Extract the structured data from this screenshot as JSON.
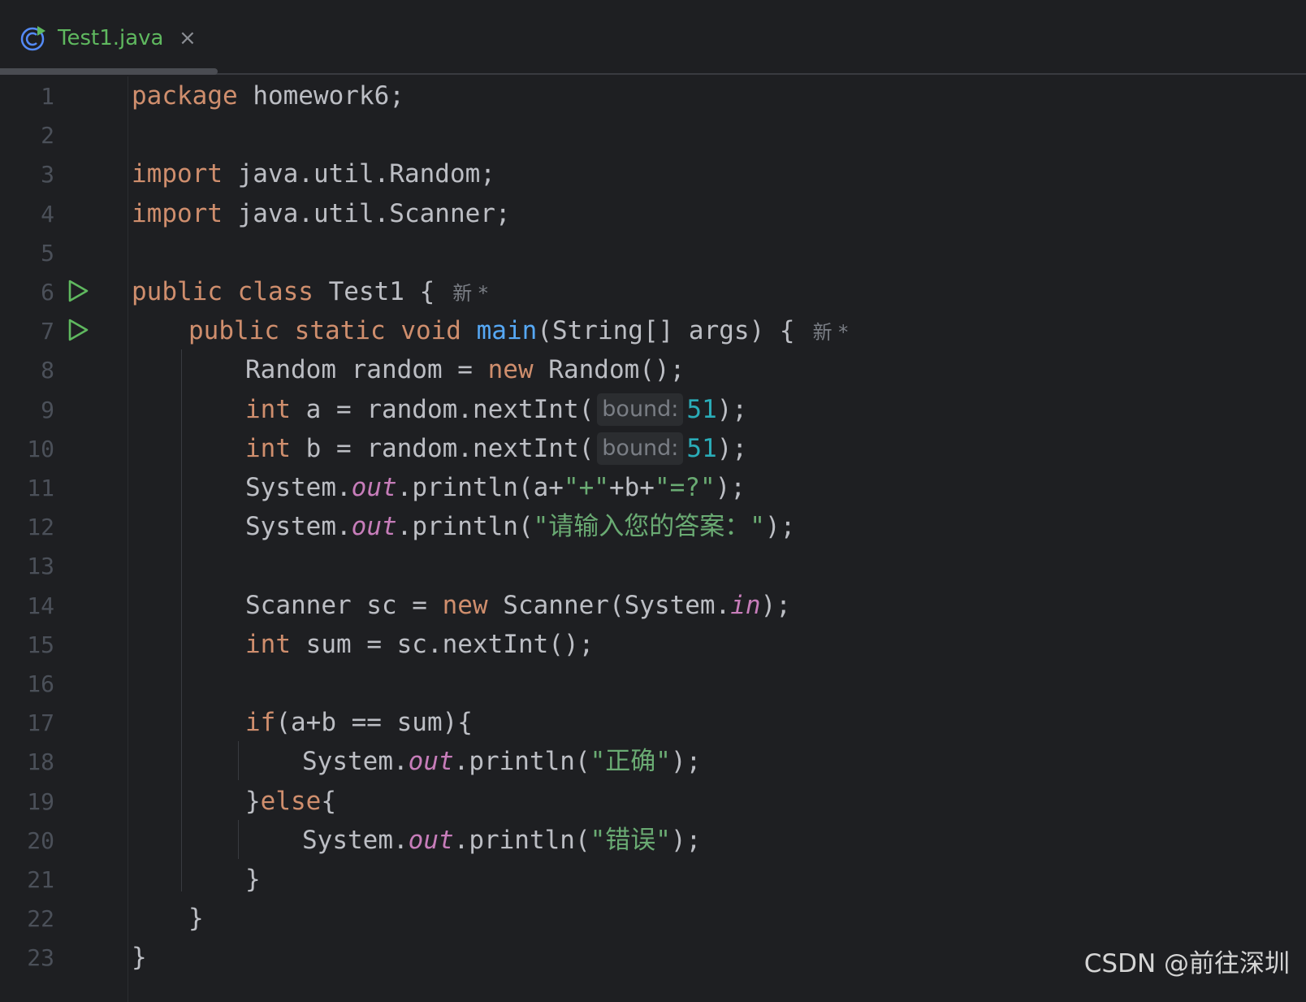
{
  "tab": {
    "title": "Test1.java",
    "close": "×"
  },
  "colors": {
    "background": "#1e1f22",
    "keyword": "#cf8e6d",
    "string": "#6aab73",
    "number": "#2aacb8",
    "field": "#c77dba",
    "method": "#56a8f5",
    "text": "#bcbec4",
    "line_number": "#4b5059",
    "run_icon": "#5fb85f"
  },
  "line_numbers": [
    "1",
    "2",
    "3",
    "4",
    "5",
    "6",
    "7",
    "8",
    "9",
    "10",
    "11",
    "12",
    "13",
    "14",
    "15",
    "16",
    "17",
    "18",
    "19",
    "20",
    "21",
    "22",
    "23"
  ],
  "code": {
    "l1_kw": "package",
    "l1_rest": " homework6;",
    "l3_kw": "import",
    "l3_rest": " java.util.Random;",
    "l4_kw": "import",
    "l4_rest": " java.util.Scanner;",
    "l6_kw1": "public",
    "l6_kw2": "class",
    "l6_rest": " Test1 {",
    "l6_inlay": "新 *",
    "l7_kw1": "public",
    "l7_kw2": "static",
    "l7_kw3": "void",
    "l7_fn": "main",
    "l7_rest": "(String[] args) {",
    "l7_inlay": "新 *",
    "l8_a": "Random random = ",
    "l8_kw": "new",
    "l8_b": " Random();",
    "l9_kw": "int",
    "l9_a": " a = random.nextInt(",
    "l9_hint": "bound:",
    "l9_num": "51",
    "l9_b": ");",
    "l10_kw": "int",
    "l10_a": " b = random.nextInt(",
    "l10_hint": "bound:",
    "l10_num": "51",
    "l10_b": ");",
    "l11_a": "System.",
    "l11_fld": "out",
    "l11_b": ".println(a+",
    "l11_s1": "\"+\"",
    "l11_c": "+b+",
    "l11_s2": "\"=?\"",
    "l11_d": ");",
    "l12_a": "System.",
    "l12_fld": "out",
    "l12_b": ".println(",
    "l12_s": "\"请输入您的答案：\"",
    "l12_c": ");",
    "l14_a": "Scanner sc = ",
    "l14_kw": "new",
    "l14_b": " Scanner(System.",
    "l14_fld": "in",
    "l14_c": ");",
    "l15_kw": "int",
    "l15_rest": " sum = sc.nextInt();",
    "l17_kw": "if",
    "l17_rest": "(a+b == sum){",
    "l18_a": "System.",
    "l18_fld": "out",
    "l18_b": ".println(",
    "l18_s": "\"正确\"",
    "l18_c": ");",
    "l19_a": "}",
    "l19_kw": "else",
    "l19_b": "{",
    "l20_a": "System.",
    "l20_fld": "out",
    "l20_b": ".println(",
    "l20_s": "\"错误\"",
    "l20_c": ");",
    "l21": "}",
    "l22": "}",
    "l23": "}"
  },
  "watermark": "CSDN @前往深圳"
}
